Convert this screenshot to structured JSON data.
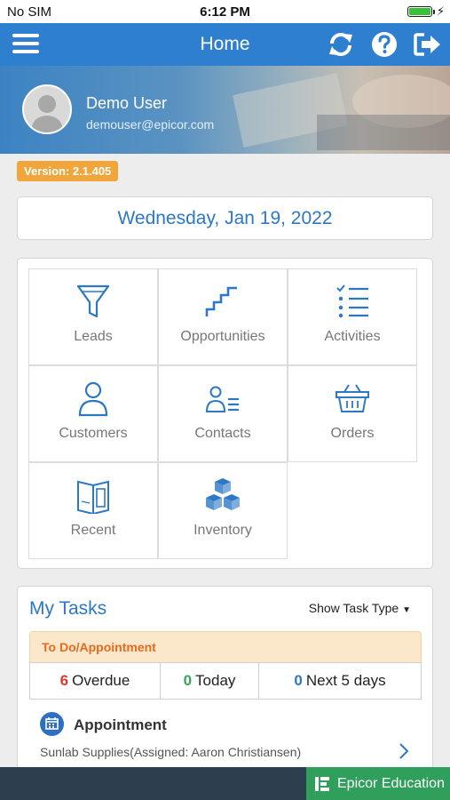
{
  "status_bar": {
    "carrier": "No SIM",
    "time": "6:12 PM",
    "battery_level": 1.0
  },
  "navbar": {
    "title": "Home",
    "icons": [
      "menu-icon",
      "refresh-icon",
      "help-icon",
      "logout-icon"
    ]
  },
  "user": {
    "name": "Demo User",
    "email": "demouser@epicor.com",
    "avatar_icon": "user-placeholder-icon"
  },
  "version": "Version: 2.1.405",
  "date": "Wednesday, Jan 19, 2022",
  "modules": [
    {
      "label": "Leads",
      "icon": "funnel-icon"
    },
    {
      "label": "Opportunities",
      "icon": "stairs-icon"
    },
    {
      "label": "Activities",
      "icon": "checklist-icon"
    },
    {
      "label": "Customers",
      "icon": "person-icon"
    },
    {
      "label": "Contacts",
      "icon": "contact-card-icon"
    },
    {
      "label": "Orders",
      "icon": "basket-icon"
    },
    {
      "label": "Recent",
      "icon": "book-icon"
    },
    {
      "label": "Inventory",
      "icon": "boxes-icon"
    }
  ],
  "tasks": {
    "title": "My Tasks",
    "filter_label": "Show Task Type",
    "section": "To Do/Appointment",
    "counts": {
      "overdue": {
        "num": "6",
        "label": "Overdue",
        "color": "#d93a2b"
      },
      "today": {
        "num": "0",
        "label": "Today",
        "color": "#3aa35a"
      },
      "next": {
        "num": "0",
        "label": "Next 5 days",
        "color": "#2c78c5"
      }
    },
    "item": {
      "title": "Appointment",
      "subtitle": "Sunlab Supplies(Assigned: Aaron Christiansen)",
      "icon": "calendar-icon"
    }
  },
  "footer": {
    "label": "Epicor Education",
    "icon": "epicor-logo-icon"
  },
  "colors": {
    "primary": "#2f7fd1",
    "accent": "#2c78c5",
    "badge": "#f0a63a",
    "edu": "#2f9f5b",
    "footer": "#2d3e4e"
  }
}
